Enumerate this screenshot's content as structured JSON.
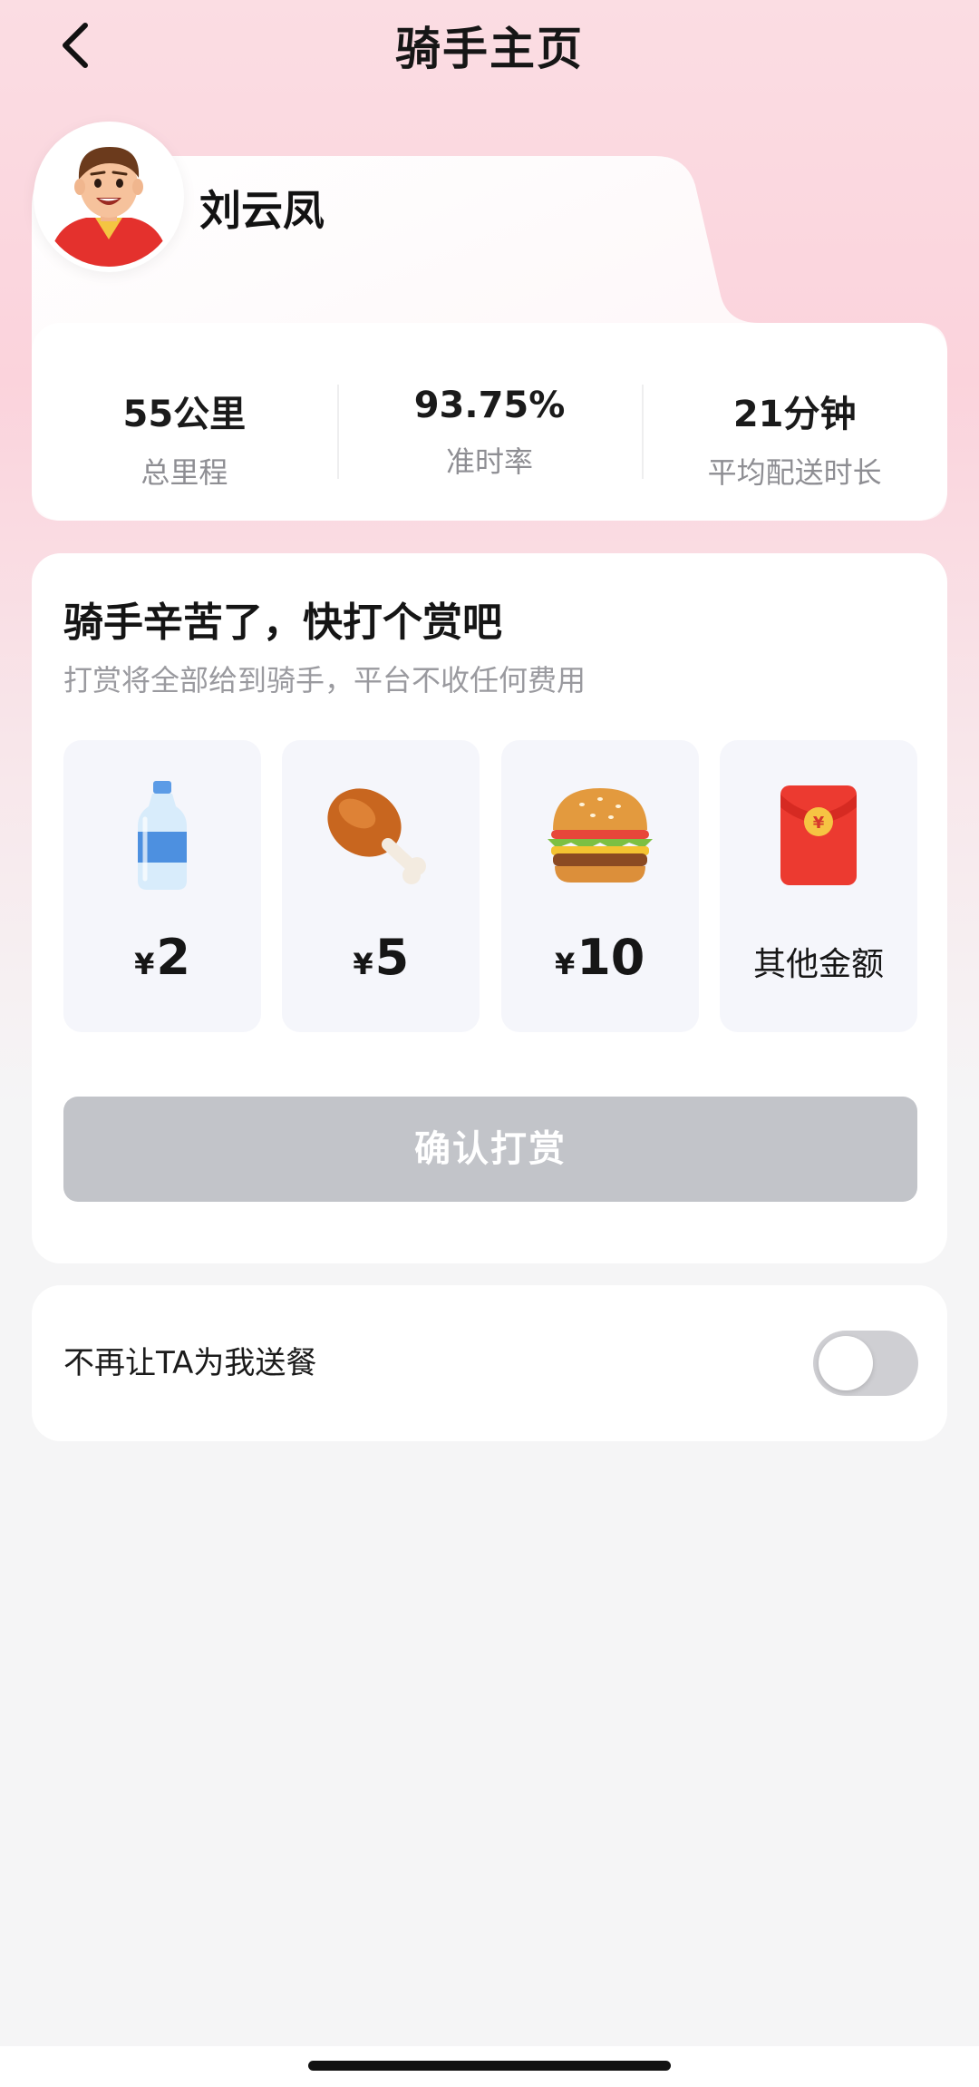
{
  "header": {
    "title": "骑手主页",
    "back_icon": "chevron-left-icon"
  },
  "profile": {
    "name": "刘云凤",
    "avatar_icon": "rider-avatar-icon",
    "stats": [
      {
        "value": "55公里",
        "label": "总里程"
      },
      {
        "value": "93.75%",
        "label": "准时率"
      },
      {
        "value": "21分钟",
        "label": "平均配送时长"
      }
    ]
  },
  "tip": {
    "title": "骑手辛苦了，快打个赏吧",
    "subtitle": "打赏将全部给到骑手，平台不收任何费用",
    "currency_symbol": "¥",
    "options": [
      {
        "icon": "water-bottle-icon",
        "amount": "2"
      },
      {
        "icon": "chicken-leg-icon",
        "amount": "5"
      },
      {
        "icon": "burger-icon",
        "amount": "10"
      },
      {
        "icon": "red-envelope-icon",
        "label": "其他金额"
      }
    ],
    "confirm_label": "确认打赏",
    "confirm_color": "#c2c4c9"
  },
  "block_rider": {
    "label": "不再让TA为我送餐",
    "enabled": false
  },
  "colors": {
    "background_top": "#fbd3dc",
    "background_bottom": "#f5f5f6",
    "red_accent": "#e8312f"
  }
}
